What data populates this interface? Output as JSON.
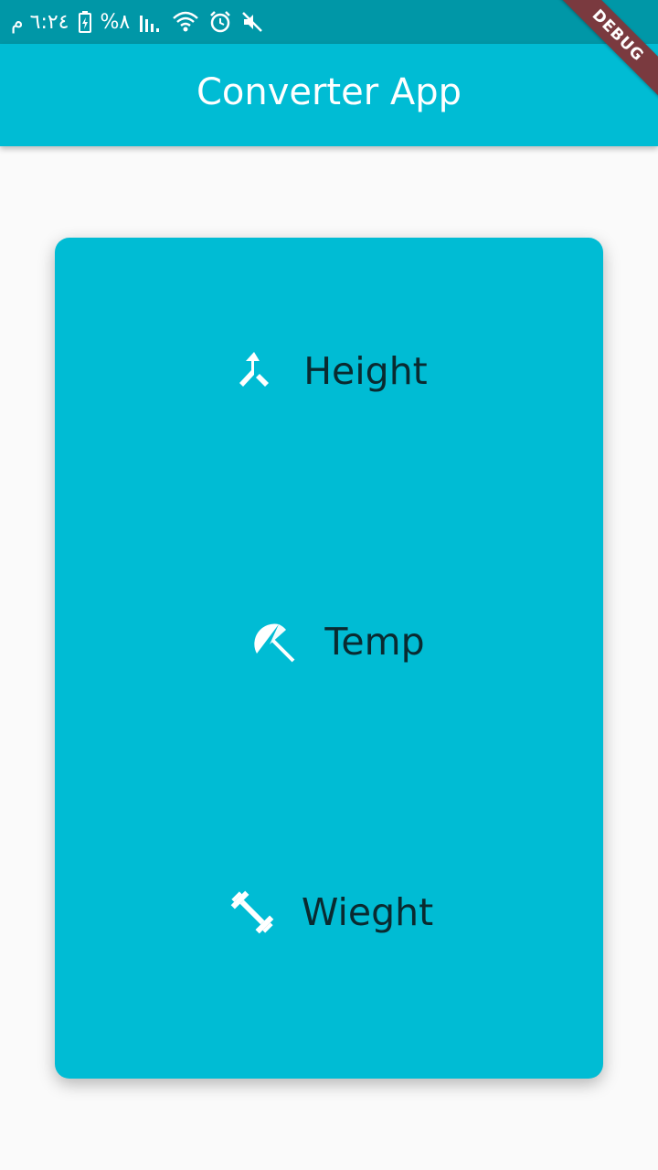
{
  "status_bar": {
    "time": "٦:٢٤ م",
    "battery": "%٨",
    "icons": [
      "battery-icon",
      "signal-icon",
      "wifi-icon",
      "alarm-icon",
      "mute-icon"
    ]
  },
  "app_bar": {
    "title": "Converter App",
    "debug_label": "DEBUG"
  },
  "menu": {
    "items": [
      {
        "label": "Height",
        "icon": "merge-icon"
      },
      {
        "label": "Temp",
        "icon": "beach-umbrella-icon"
      },
      {
        "label": "Wieght",
        "icon": "dumbbell-icon"
      }
    ]
  },
  "colors": {
    "primary": "#00bcd4",
    "primary_dark": "#0097a7",
    "background": "#fafafa",
    "label_text": "#0a2a30",
    "debug": "#7a3a3f"
  }
}
